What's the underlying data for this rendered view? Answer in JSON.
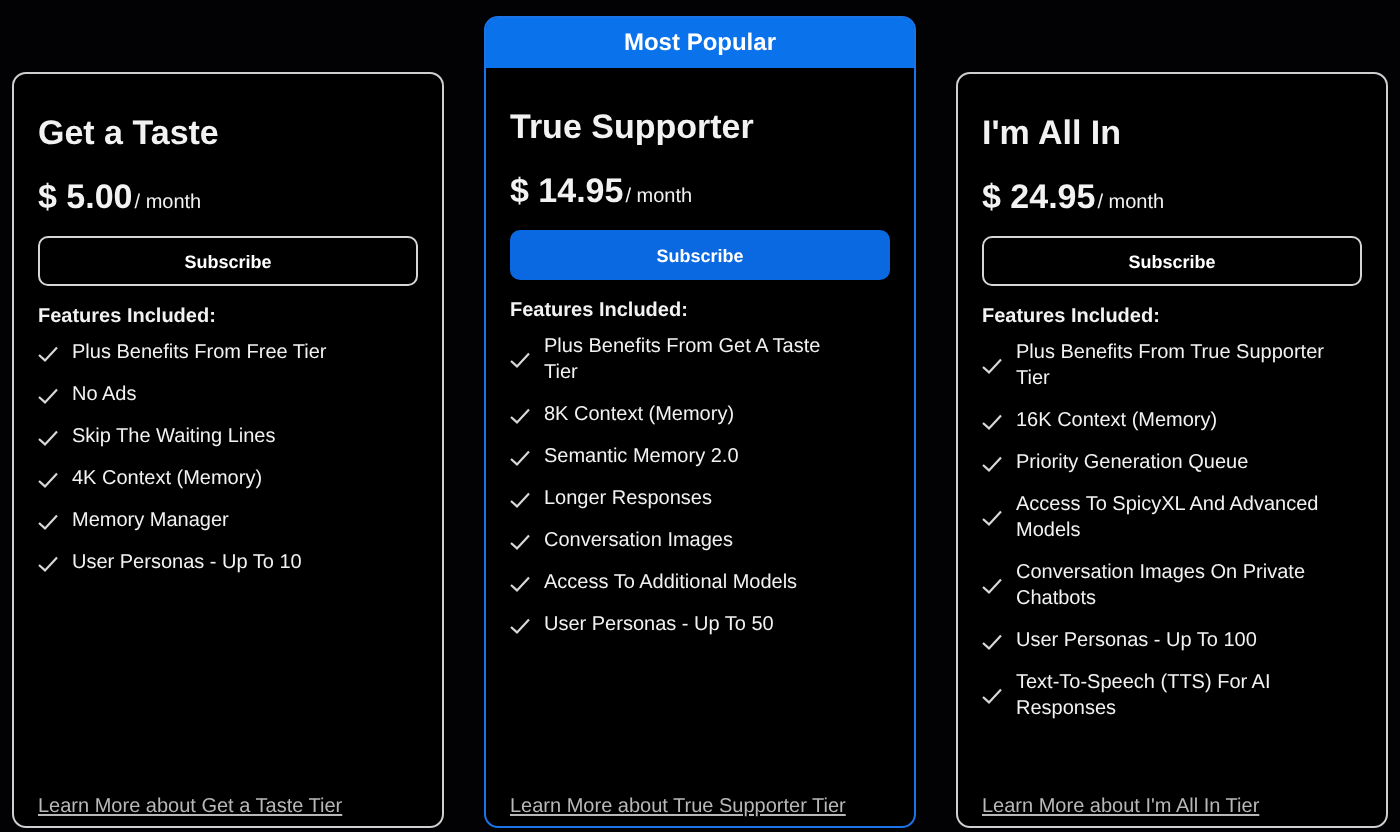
{
  "plans": [
    {
      "name": "Get a Taste",
      "price": "$ 5.00",
      "period": "/ month",
      "highlighted": false,
      "button": "Subscribe",
      "features_heading": "Features Included:",
      "features": [
        "Plus Benefits From Free Tier",
        "No Ads",
        "Skip The Waiting Lines",
        "4K Context (Memory)",
        "Memory Manager",
        "User Personas - Up To 10"
      ],
      "link": "Learn More about Get a Taste Tier"
    },
    {
      "badge": "Most Popular",
      "name": "True Supporter",
      "price": "$ 14.95",
      "period": "/ month",
      "highlighted": true,
      "button": "Subscribe",
      "features_heading": "Features Included:",
      "features": [
        "Plus Benefits From Get A Taste Tier",
        "8K Context (Memory)",
        "Semantic Memory 2.0",
        "Longer Responses",
        "Conversation Images",
        "Access To Additional Models",
        "User Personas - Up To 50"
      ],
      "link": "Learn More about True Supporter Tier"
    },
    {
      "name": "I'm All In",
      "price": "$ 24.95",
      "period": "/ month",
      "highlighted": false,
      "button": "Subscribe",
      "features_heading": "Features Included:",
      "features": [
        "Plus Benefits From True Supporter Tier",
        "16K Context (Memory)",
        "Priority Generation Queue",
        "Access To SpicyXL And Advanced Models",
        "Conversation Images On Private Chatbots",
        "User Personas - Up To 100",
        "Text-To-Speech (TTS) For AI Responses"
      ],
      "link": "Learn More about I'm All In Tier"
    }
  ]
}
